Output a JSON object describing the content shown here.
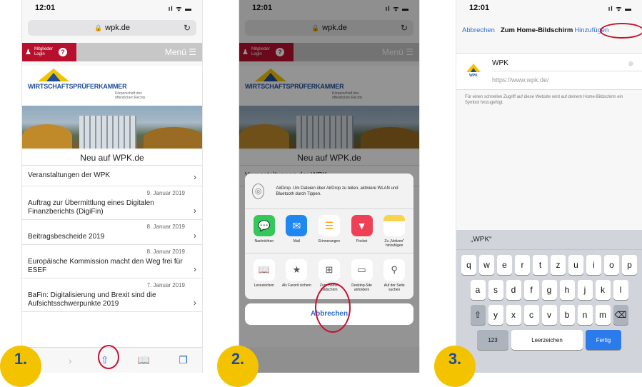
{
  "status": {
    "time": "12:01",
    "icons": "ıl ᯤ ▬"
  },
  "browser": {
    "url": "wpk.de",
    "lock": "🔒",
    "reload": "↻"
  },
  "site": {
    "member_label": "Mitglieder Login",
    "help": "?",
    "menu": "Menü ☰",
    "brand": "WIRTSCHAFTSPRÜFERKAMMER",
    "brand_sub": "Körperschaft des öffentlichen Rechts",
    "section_title": "Neu auf WPK.de",
    "news": [
      {
        "date": "",
        "title": "Veranstaltungen der WPK"
      },
      {
        "date": "9. Januar 2019",
        "title": "Auftrag zur Übermittlung eines Digitalen Finanzberichts (DigiFin)"
      },
      {
        "date": "8. Januar 2019",
        "title": "Beitragsbescheide 2019"
      },
      {
        "date": "8. Januar 2019",
        "title": "Europäische Kommission macht den Weg frei für ESEF"
      },
      {
        "date": "7. Januar 2019",
        "title": "BaFin: Digitalisierung und Brexit sind die Aufsichtsschwerpunkte 2019"
      }
    ],
    "chevron": "›"
  },
  "toolbar": {
    "back": "‹",
    "forward": "›",
    "share": "⇧",
    "bookmarks": "📖",
    "tabs": "❐"
  },
  "sheet": {
    "airdrop_text": "AirDrop. Um Dateien über AirDrop zu teilen, aktiviere WLAN und Bluetooth durch Tippen.",
    "apps": [
      {
        "label": "Nachrichten",
        "glyph": "💬",
        "color": "#34c759"
      },
      {
        "label": "Mail",
        "glyph": "✉",
        "color": "#1e88f0"
      },
      {
        "label": "Erinnerungen",
        "glyph": "☰",
        "color": "#ffffff"
      },
      {
        "label": "Pocket",
        "glyph": "▼",
        "color": "#ef4056"
      },
      {
        "label": "Zu „Notizen“ hinzufügen",
        "glyph": "",
        "color": "#f7d44c"
      }
    ],
    "actions": [
      {
        "label": "Lesezeichen",
        "glyph": "📖"
      },
      {
        "label": "Als Favorit sichern",
        "glyph": "★"
      },
      {
        "label": "Zum Home-Bildschirm",
        "glyph": "⊞"
      },
      {
        "label": "Desktop-Site anfordern",
        "glyph": "▭"
      },
      {
        "label": "Auf der Seite suchen",
        "glyph": "⚲"
      }
    ],
    "cancel": "Abbrechen"
  },
  "add_home": {
    "cancel": "Abbrechen",
    "title": "Zum Home-Bildschirm",
    "add": "Hinzufügen",
    "name": "WPK",
    "url": "https://www.wpk.de/",
    "hint": "Für einen schnellen Zugriff auf diese Website wird auf deinem Home-Bildschirm ein Symbol hinzugefügt.",
    "suggestion": "„WPK“",
    "keys_row1": [
      "q",
      "w",
      "e",
      "r",
      "t",
      "z",
      "u",
      "i",
      "o",
      "p"
    ],
    "keys_row2": [
      "a",
      "s",
      "d",
      "f",
      "g",
      "h",
      "j",
      "k",
      "l"
    ],
    "keys_row3": [
      "⇧",
      "y",
      "x",
      "c",
      "v",
      "b",
      "n",
      "m",
      "⌫"
    ],
    "key_123": "123",
    "key_space": "Leerzeichen",
    "key_done": "Fertig",
    "thumb_label": "WPK"
  },
  "steps": [
    "1.",
    "2.",
    "3."
  ],
  "colors": {
    "accent": "#2b6cd1",
    "brand_red": "#b7102c",
    "badge": "#f4c300",
    "highlight": "#c8102e"
  }
}
